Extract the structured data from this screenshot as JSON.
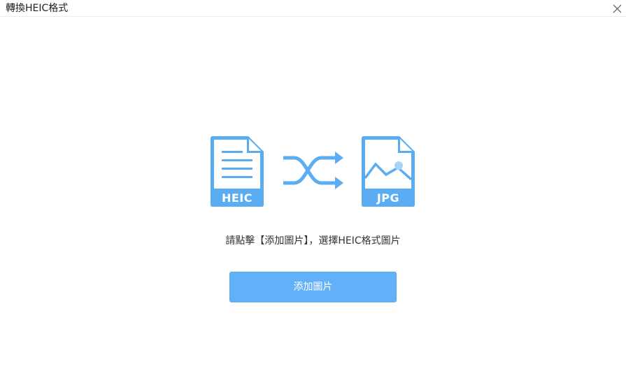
{
  "window": {
    "title": "轉換HEIC格式",
    "close_icon": "close-icon"
  },
  "illustration": {
    "source_label": "HEIC",
    "target_label": "JPG",
    "source_icon": "document-icon",
    "arrows_icon": "shuffle-arrows-icon",
    "target_icon": "image-file-icon",
    "accent_color": "#5aacf3"
  },
  "main": {
    "instruction": "請點擊【添加圖片】，選擇HEIC格式圖片",
    "add_button_label": "添加圖片",
    "button_color": "#62b0f7"
  }
}
